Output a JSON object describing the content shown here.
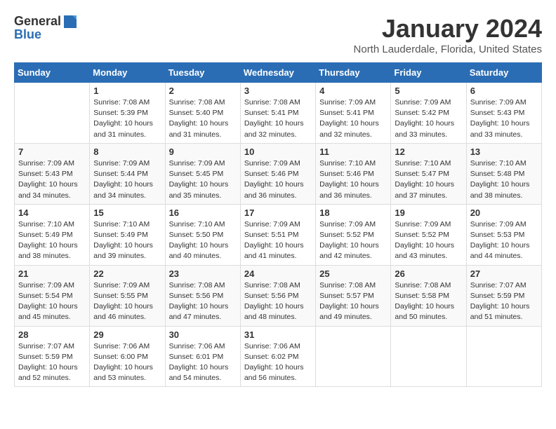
{
  "header": {
    "logo_general": "General",
    "logo_blue": "Blue",
    "month_title": "January 2024",
    "location": "North Lauderdale, Florida, United States"
  },
  "days_of_week": [
    "Sunday",
    "Monday",
    "Tuesday",
    "Wednesday",
    "Thursday",
    "Friday",
    "Saturday"
  ],
  "weeks": [
    [
      {
        "day": "",
        "info": ""
      },
      {
        "day": "1",
        "info": "Sunrise: 7:08 AM\nSunset: 5:39 PM\nDaylight: 10 hours\nand 31 minutes."
      },
      {
        "day": "2",
        "info": "Sunrise: 7:08 AM\nSunset: 5:40 PM\nDaylight: 10 hours\nand 31 minutes."
      },
      {
        "day": "3",
        "info": "Sunrise: 7:08 AM\nSunset: 5:41 PM\nDaylight: 10 hours\nand 32 minutes."
      },
      {
        "day": "4",
        "info": "Sunrise: 7:09 AM\nSunset: 5:41 PM\nDaylight: 10 hours\nand 32 minutes."
      },
      {
        "day": "5",
        "info": "Sunrise: 7:09 AM\nSunset: 5:42 PM\nDaylight: 10 hours\nand 33 minutes."
      },
      {
        "day": "6",
        "info": "Sunrise: 7:09 AM\nSunset: 5:43 PM\nDaylight: 10 hours\nand 33 minutes."
      }
    ],
    [
      {
        "day": "7",
        "info": "Sunrise: 7:09 AM\nSunset: 5:43 PM\nDaylight: 10 hours\nand 34 minutes."
      },
      {
        "day": "8",
        "info": "Sunrise: 7:09 AM\nSunset: 5:44 PM\nDaylight: 10 hours\nand 34 minutes."
      },
      {
        "day": "9",
        "info": "Sunrise: 7:09 AM\nSunset: 5:45 PM\nDaylight: 10 hours\nand 35 minutes."
      },
      {
        "day": "10",
        "info": "Sunrise: 7:09 AM\nSunset: 5:46 PM\nDaylight: 10 hours\nand 36 minutes."
      },
      {
        "day": "11",
        "info": "Sunrise: 7:10 AM\nSunset: 5:46 PM\nDaylight: 10 hours\nand 36 minutes."
      },
      {
        "day": "12",
        "info": "Sunrise: 7:10 AM\nSunset: 5:47 PM\nDaylight: 10 hours\nand 37 minutes."
      },
      {
        "day": "13",
        "info": "Sunrise: 7:10 AM\nSunset: 5:48 PM\nDaylight: 10 hours\nand 38 minutes."
      }
    ],
    [
      {
        "day": "14",
        "info": "Sunrise: 7:10 AM\nSunset: 5:49 PM\nDaylight: 10 hours\nand 38 minutes."
      },
      {
        "day": "15",
        "info": "Sunrise: 7:10 AM\nSunset: 5:49 PM\nDaylight: 10 hours\nand 39 minutes."
      },
      {
        "day": "16",
        "info": "Sunrise: 7:10 AM\nSunset: 5:50 PM\nDaylight: 10 hours\nand 40 minutes."
      },
      {
        "day": "17",
        "info": "Sunrise: 7:09 AM\nSunset: 5:51 PM\nDaylight: 10 hours\nand 41 minutes."
      },
      {
        "day": "18",
        "info": "Sunrise: 7:09 AM\nSunset: 5:52 PM\nDaylight: 10 hours\nand 42 minutes."
      },
      {
        "day": "19",
        "info": "Sunrise: 7:09 AM\nSunset: 5:52 PM\nDaylight: 10 hours\nand 43 minutes."
      },
      {
        "day": "20",
        "info": "Sunrise: 7:09 AM\nSunset: 5:53 PM\nDaylight: 10 hours\nand 44 minutes."
      }
    ],
    [
      {
        "day": "21",
        "info": "Sunrise: 7:09 AM\nSunset: 5:54 PM\nDaylight: 10 hours\nand 45 minutes."
      },
      {
        "day": "22",
        "info": "Sunrise: 7:09 AM\nSunset: 5:55 PM\nDaylight: 10 hours\nand 46 minutes."
      },
      {
        "day": "23",
        "info": "Sunrise: 7:08 AM\nSunset: 5:56 PM\nDaylight: 10 hours\nand 47 minutes."
      },
      {
        "day": "24",
        "info": "Sunrise: 7:08 AM\nSunset: 5:56 PM\nDaylight: 10 hours\nand 48 minutes."
      },
      {
        "day": "25",
        "info": "Sunrise: 7:08 AM\nSunset: 5:57 PM\nDaylight: 10 hours\nand 49 minutes."
      },
      {
        "day": "26",
        "info": "Sunrise: 7:08 AM\nSunset: 5:58 PM\nDaylight: 10 hours\nand 50 minutes."
      },
      {
        "day": "27",
        "info": "Sunrise: 7:07 AM\nSunset: 5:59 PM\nDaylight: 10 hours\nand 51 minutes."
      }
    ],
    [
      {
        "day": "28",
        "info": "Sunrise: 7:07 AM\nSunset: 5:59 PM\nDaylight: 10 hours\nand 52 minutes."
      },
      {
        "day": "29",
        "info": "Sunrise: 7:06 AM\nSunset: 6:00 PM\nDaylight: 10 hours\nand 53 minutes."
      },
      {
        "day": "30",
        "info": "Sunrise: 7:06 AM\nSunset: 6:01 PM\nDaylight: 10 hours\nand 54 minutes."
      },
      {
        "day": "31",
        "info": "Sunrise: 7:06 AM\nSunset: 6:02 PM\nDaylight: 10 hours\nand 56 minutes."
      },
      {
        "day": "",
        "info": ""
      },
      {
        "day": "",
        "info": ""
      },
      {
        "day": "",
        "info": ""
      }
    ]
  ]
}
